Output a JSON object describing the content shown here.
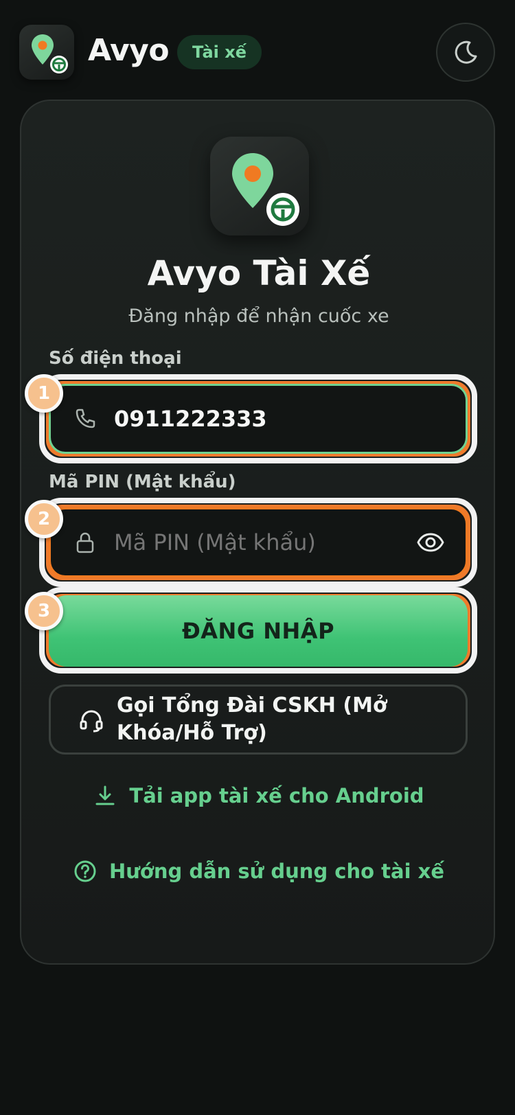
{
  "header": {
    "app_name": "Avyo",
    "badge": "Tài xế",
    "theme_icon": "moon-icon"
  },
  "card": {
    "title": "Avyo Tài Xế",
    "subtitle": "Đăng nhập để nhận cuốc xe",
    "phone": {
      "label": "Số điện thoại",
      "value": "0911222333",
      "icon": "phone-icon"
    },
    "pin": {
      "label": "Mã PIN (Mật khẩu)",
      "placeholder": "Mã PIN (Mật khẩu)",
      "icon": "lock-icon",
      "toggle_icon": "eye-icon"
    },
    "login_label": "ĐĂNG NHẬP",
    "support_label": "Gọi Tổng Đài CSKH (Mở Khóa/Hỗ Trợ)",
    "download_label": "Tải app tài xế cho Android",
    "guide_label": "Hướng dẫn sử dụng cho tài xế"
  },
  "steps": [
    "1",
    "2",
    "3"
  ],
  "colors": {
    "background": "#0f1211",
    "card": "#1b1f1d",
    "accent_green": "#3fc375",
    "link_green": "#66cf8e",
    "pin_orange": "#f07a22",
    "highlight_orange": "#ef7a2b",
    "step_badge": "#f6c18e"
  }
}
